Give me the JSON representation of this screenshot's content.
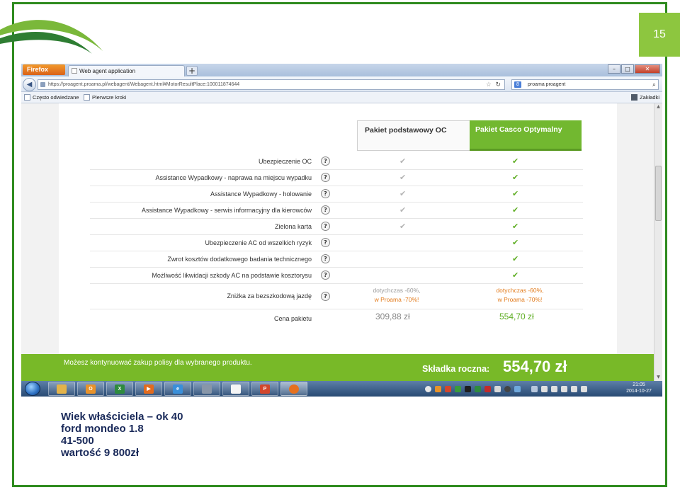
{
  "slide": {
    "page_number": "15",
    "caption_lines": [
      "Wiek  właściciela – ok 40",
      "ford mondeo 1.8",
      "41-500",
      "wartość 9 800zł"
    ],
    "accent_color": "#8dc63f",
    "frame_color": "#2e8b1e"
  },
  "browser": {
    "menu_label": "Firefox",
    "tab_title": "Web agent application",
    "new_tab": "+",
    "window_controls": [
      "–",
      "□",
      "✕"
    ],
    "url": "https://proagent.proama.pl/webagent/Webagent.html#MotorResultPlace:100011874644",
    "search_engine": "8",
    "search_value": "proama proagent",
    "bookmarks": [
      "Często odwiedzane",
      "Pierwsze kroki"
    ],
    "bookmarks_right": "Zakładki"
  },
  "packages": {
    "basic": "Pakiet podstawowy OC",
    "casco": "Pakiet Casco Optymalny"
  },
  "coverage": [
    {
      "label": "Ubezpieczenie OC",
      "basic": "✔",
      "casco": "✔"
    },
    {
      "label": "Assistance Wypadkowy - naprawa na miejscu wypadku",
      "basic": "✔",
      "casco": "✔"
    },
    {
      "label": "Assistance Wypadkowy - holowanie",
      "basic": "✔",
      "casco": "✔"
    },
    {
      "label": "Assistance Wypadkowy - serwis informacyjny dla kierowców",
      "basic": "✔",
      "casco": "✔"
    },
    {
      "label": "Zielona karta",
      "basic": "✔",
      "casco": "✔"
    },
    {
      "label": "Ubezpieczenie AC od wszelkich ryzyk",
      "basic": "",
      "casco": "✔"
    },
    {
      "label": "Zwrot kosztów dodatkowego badania technicznego",
      "basic": "",
      "casco": "✔"
    },
    {
      "label": "Możliwość likwidacji szkody AC na podstawie kosztorysu",
      "basic": "",
      "casco": "✔"
    }
  ],
  "help_glyph": "?",
  "discount": {
    "label": "Zniżka za bezszkodową jazdę",
    "basic_line1": "dotychczas -60%,",
    "basic_line2": "w Proama -70%!",
    "casco_line1": "dotychczas -60%,",
    "casco_line2": "w Proama -70%!"
  },
  "price": {
    "label": "Cena pakietu",
    "basic": "309,88 zł",
    "casco": "554,70 zł"
  },
  "banner": {
    "message": "Możesz kontynuować zakup polisy dla wybranego produktu.",
    "label": "Składka roczna:",
    "price": "554,70 zł"
  },
  "taskbar": {
    "clock_time": "21:05",
    "clock_date": "2014-10-27"
  }
}
